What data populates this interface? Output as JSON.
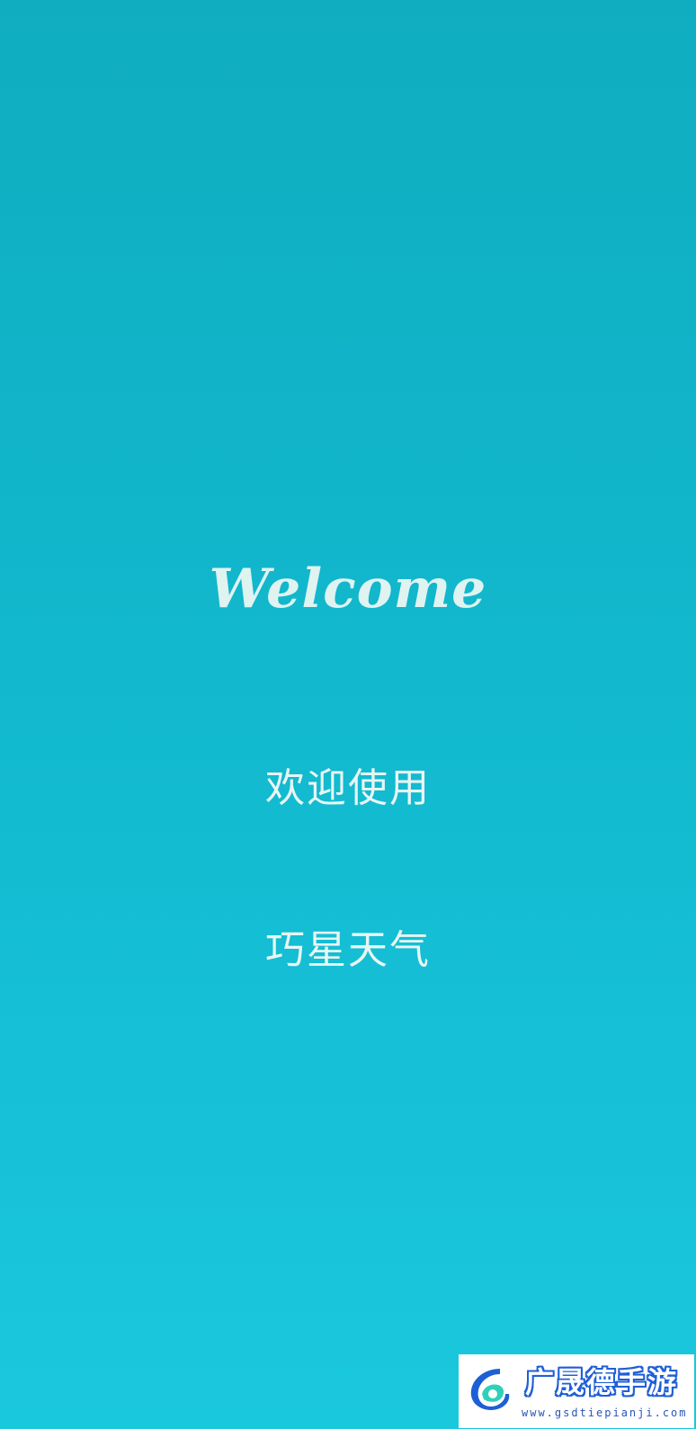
{
  "splash": {
    "welcome": "Welcome",
    "greeting": "欢迎使用",
    "app_name": "巧星天气"
  },
  "watermark": {
    "title": "广晟德手游",
    "url": "www.gsdtiepianji.com"
  },
  "colors": {
    "background_top": "#0fadbf",
    "background_bottom": "#1ac8de",
    "text": "#e8f6f4",
    "watermark_blue": "#1f5fd6"
  }
}
